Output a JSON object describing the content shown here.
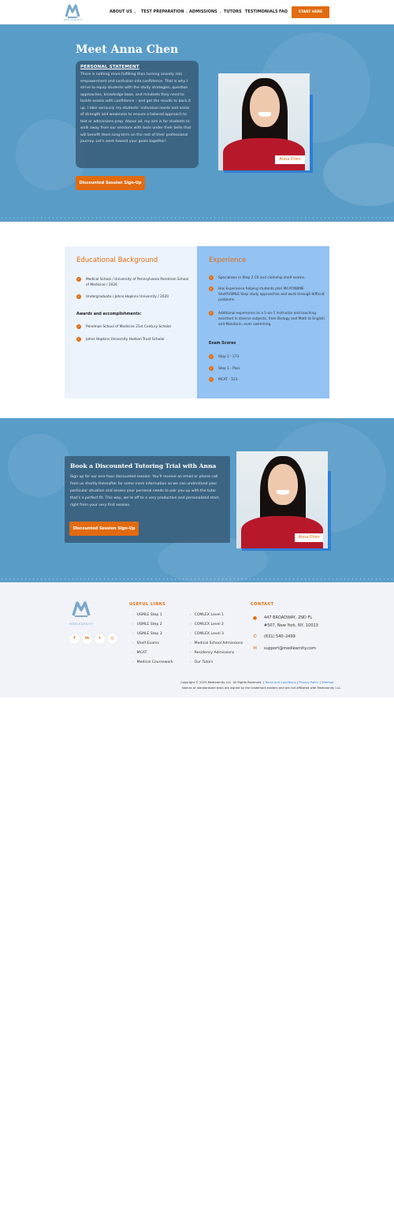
{
  "header": {
    "logo_text": "MEDLEARNITY",
    "nav": [
      {
        "label": "ABOUT US",
        "dropdown": true
      },
      {
        "label": "TEST PREPARATION",
        "dropdown": true
      },
      {
        "label": "ADMISSIONS",
        "dropdown": true
      },
      {
        "label": "TUTORS",
        "dropdown": false
      },
      {
        "label": "TESTIMONIALS",
        "dropdown": false
      },
      {
        "label": "FAQ",
        "dropdown": false
      }
    ],
    "cta": "START HERE"
  },
  "hero": {
    "title": "Meet Anna Chen",
    "statement_label": "PERSONAL STATEMENT",
    "statement": "There is nothing more fulfilling than turning anxiety into empowerment and confusion into confidence. That is why I strive to equip students with the study strategies, question approaches, knowledge base, and mindsets they need to tackle exams with confidence – and get the results to back it up. I take seriously my students’ individual needs and areas of strength and weakness to ensure a tailored approach to test or admissions prep. Above all, my aim is for students to walk away from our sessions with tools under their belts that will benefit them long-term on the rest of their professional journey. Let’s work toward your goals together!",
    "button": "Discounted Session Sign-Up",
    "name_tag": "Anna Chen"
  },
  "education": {
    "title": "Educational Background",
    "items": [
      "Medical School / University of Pennsylvania Perelman School of Medicine / 2026",
      "Undergraduate / Johns Hopkins University / 2020"
    ],
    "awards_heading": "Awards and accomplishments:",
    "awards": [
      "Perelman School of Medicine 21st Century Scholar",
      "Johns Hopkins University Hodson Trust Scholar"
    ]
  },
  "experience": {
    "title": "Experience",
    "items": [
      "Specializes in Step 2 CK and clerkship shelf exams.",
      "Has Experience helping students plan MCAT/NBME Shelf/USMLE Step study approaches and work through difficult problems.",
      "Additional experience as a 1-on-1 instructor and teaching assistant in diverse subjects, from Biology and Math to English and Mandarin, even swimming."
    ],
    "scores_heading": "Exam Scores",
    "scores": [
      "Step 2 - 273",
      "Step 1 - Pass",
      "MCAT - 523"
    ]
  },
  "book": {
    "title": "Book a Discounted Tutoring Trial with Anna",
    "text": "Sign up for our one-hour discounted session. You’ll receive an email or phone call from us shortly thereafter for some more information so we can understand your particular situation and assess your personal needs to pair you up with the tutor that’s a perfect fit. This way, we’re off to a very productive and personalized start, right from your very first session.",
    "button": "Discounted Session Sign-Up",
    "name_tag": "Anna Chen"
  },
  "footer": {
    "logo_text": "MEDLEARNITY",
    "useful_links_heading": "USEFUL LINKS",
    "links_col1": [
      "USMLE Step 1",
      "USMLE Step 2",
      "USMLE Step 3",
      "Shelf Exams",
      "MCAT",
      "Medical Coursework"
    ],
    "links_col2": [
      "COMLEX Level 1",
      "COMLEX Level 2",
      "COMLEX Level 3",
      "Medical School Admissions",
      "Residency Admissions",
      "Our Tutors"
    ],
    "contact_heading": "CONTACT",
    "address_line1": "447 BROADWAY, 2ND FL",
    "address_line2": "#507, New York, NY, 10013",
    "phone": "(631) 540–2499",
    "email": "support@medlearnity.com",
    "copyright": "Copyright © 2025 Medlearnity LLC. All Rights Reserved. |",
    "terms": "Terms and Conditions",
    "privacy": "Privacy Policy",
    "sitemap": "Sitemap",
    "disclaimer": "Names of standardized tests are owned by the trademark holders and are not affiliated with Medlearnity LLC."
  },
  "colors": {
    "accent": "#e26b10",
    "hero_blue": "#5a9cc8",
    "panel_blue": "#93c2f3"
  }
}
